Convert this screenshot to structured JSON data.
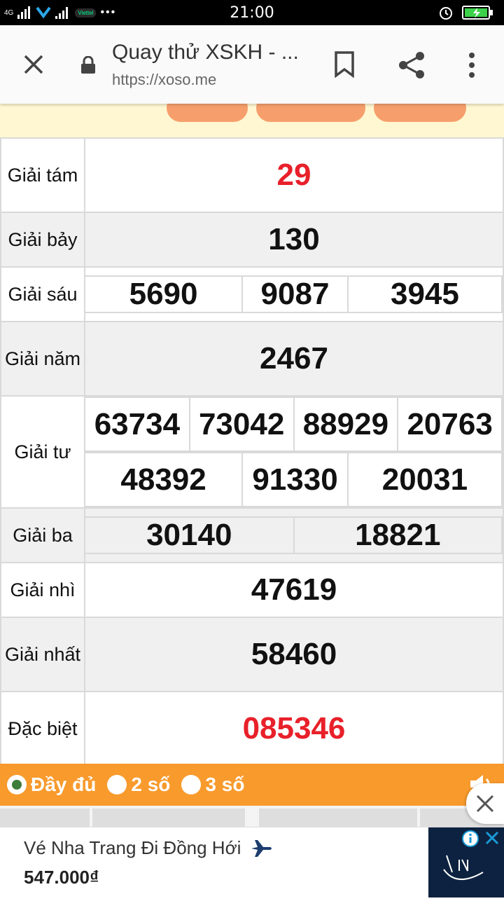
{
  "status_bar": {
    "time": "21:00",
    "network": "4G",
    "carrier": "Viettel"
  },
  "browser": {
    "title": "Quay thử XSKH - ...",
    "url": "https://xoso.me"
  },
  "results": [
    {
      "label": "Giải tám",
      "numbers": [
        "29"
      ],
      "highlight": true
    },
    {
      "label": "Giải bảy",
      "numbers": [
        "130"
      ]
    },
    {
      "label": "Giải sáu",
      "numbers": [
        "5690",
        "9087",
        "3945"
      ]
    },
    {
      "label": "Giải năm",
      "numbers": [
        "2467"
      ]
    },
    {
      "label": "Giải tư",
      "numbers": [
        "63734",
        "73042",
        "88929",
        "20763",
        "48392",
        "91330",
        "20031"
      ]
    },
    {
      "label": "Giải ba",
      "numbers": [
        "30140",
        "18821"
      ]
    },
    {
      "label": "Giải nhì",
      "numbers": [
        "47619"
      ]
    },
    {
      "label": "Giải nhất",
      "numbers": [
        "58460"
      ]
    },
    {
      "label": "Đặc biệt",
      "numbers": [
        "085346"
      ],
      "highlight": true
    }
  ],
  "options": [
    {
      "label": "Đầy đủ",
      "selected": true
    },
    {
      "label": "2 số",
      "selected": false
    },
    {
      "label": "3 số",
      "selected": false
    }
  ],
  "ad": {
    "title": "Vé Nha Trang Đi Đồng Hới",
    "price": "547.000₫"
  },
  "colors": {
    "highlight": "#e8202a",
    "options_bar": "#f89a2c",
    "radio_selected": "#3e7c3a"
  },
  "icons": [
    "close-icon",
    "lock-icon",
    "bookmark-icon",
    "share-icon",
    "more-vert-icon",
    "speaker-icon",
    "airplane-icon",
    "info-icon"
  ]
}
